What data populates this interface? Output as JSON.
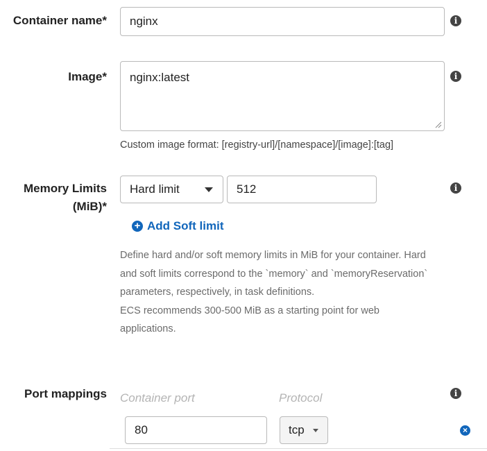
{
  "container_name": {
    "label": "Container name*",
    "value": "nginx",
    "info_icon": "info-icon"
  },
  "image": {
    "label": "Image*",
    "value": "nginx:latest",
    "hint": "Custom image format: [registry-url]/[namespace]/[image]:[tag]",
    "info_icon": "info-icon"
  },
  "memory_limits": {
    "label_line1": "Memory Limits",
    "label_line2": "(MiB)*",
    "limit_type": "Hard limit",
    "value": "512",
    "add_soft_limit": "Add Soft limit",
    "help_lines": [
      "Define hard and/or soft memory limits in MiB for your container. Hard",
      "and soft limits correspond to the `memory` and `memoryReservation`",
      "parameters, respectively, in task definitions.",
      "ECS recommends 300-500 MiB as a starting point for web",
      "applications."
    ],
    "info_icon": "info-icon"
  },
  "port_mappings": {
    "label": "Port mappings",
    "container_port_header": "Container port",
    "protocol_header": "Protocol",
    "rows": [
      {
        "container_port": "80",
        "protocol": "tcp"
      }
    ],
    "info_icon": "info-icon",
    "remove_icon": "remove-icon"
  },
  "colors": {
    "link_blue": "#1166bb",
    "icon_dark": "#444444",
    "border": "#b9b9b9",
    "help_text": "#6b6b6b",
    "placeholder": "#b4b4b4"
  }
}
